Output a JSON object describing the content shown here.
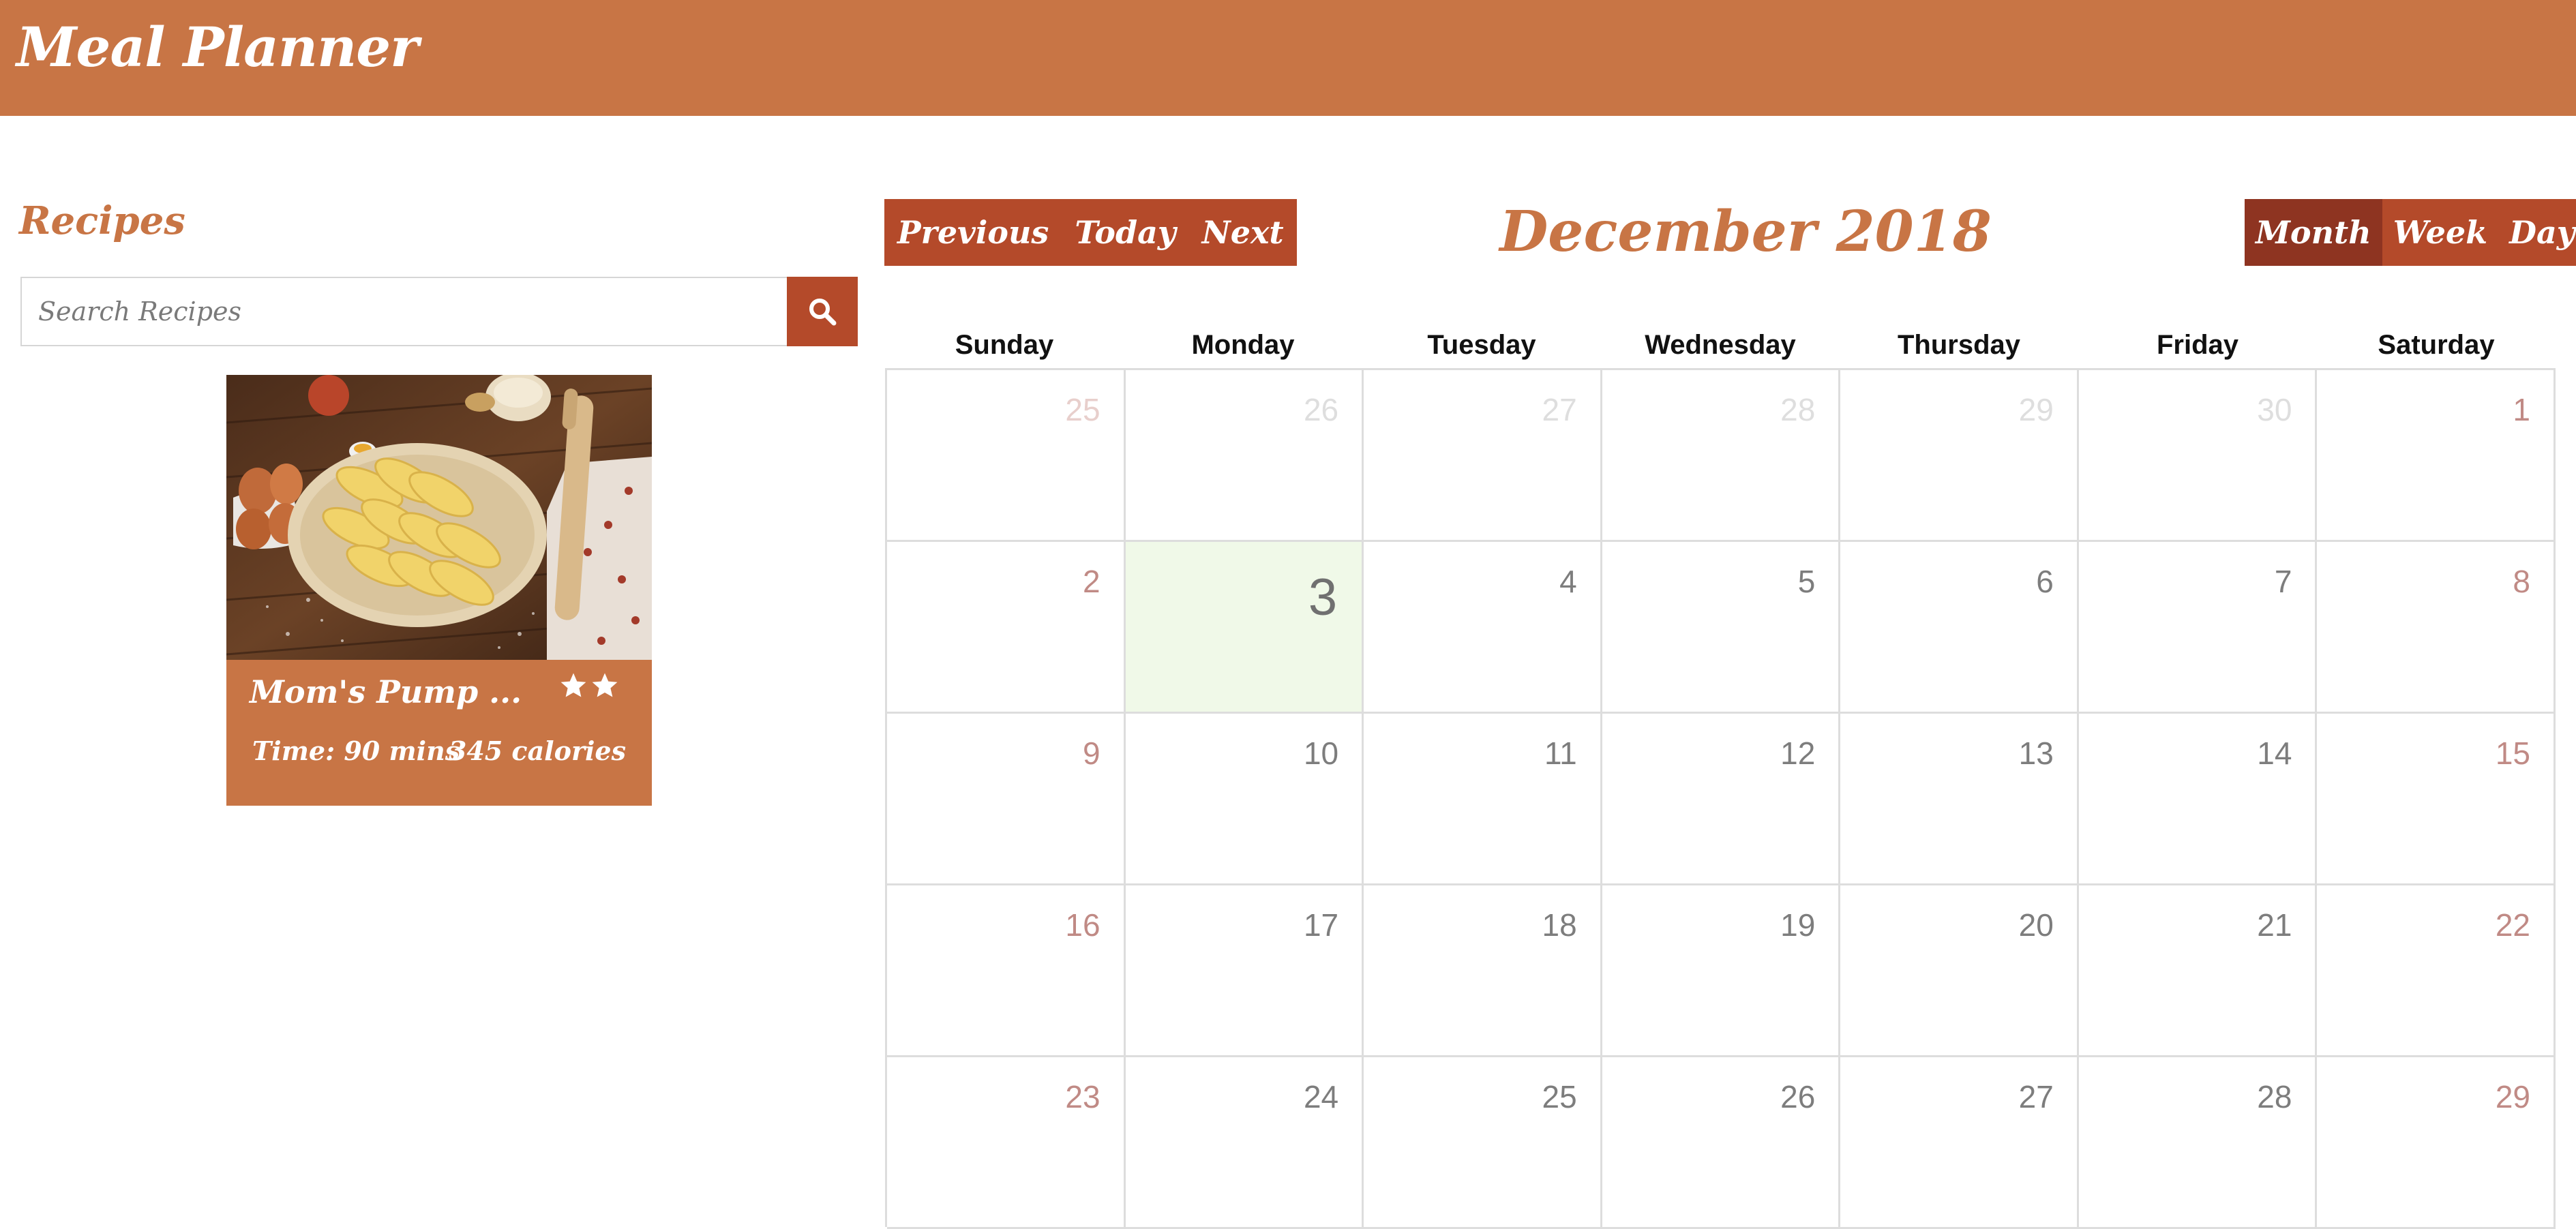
{
  "app": {
    "title": "Meal Planner"
  },
  "sidebar": {
    "heading": "Recipes",
    "search": {
      "placeholder": "Search Recipes",
      "value": ""
    },
    "recipes": [
      {
        "name": "Mom's Pump ...",
        "stars": 2,
        "time": "Time: 90 mins",
        "calories": "345 calories"
      }
    ]
  },
  "calendar": {
    "nav": {
      "previous": "Previous",
      "today": "Today",
      "next": "Next"
    },
    "title": "December 2018",
    "views": {
      "month": "Month",
      "week": "Week",
      "day": "Day",
      "active": "month"
    },
    "weekdays": [
      "Sunday",
      "Monday",
      "Tuesday",
      "Wednesday",
      "Thursday",
      "Friday",
      "Saturday"
    ],
    "weeks": [
      [
        "25",
        "26",
        "27",
        "28",
        "29",
        "30",
        "1"
      ],
      [
        "2",
        "3",
        "4",
        "5",
        "6",
        "7",
        "8"
      ],
      [
        "9",
        "10",
        "11",
        "12",
        "13",
        "14",
        "15"
      ],
      [
        "16",
        "17",
        "18",
        "19",
        "20",
        "21",
        "22"
      ],
      [
        "23",
        "24",
        "25",
        "26",
        "27",
        "28",
        "29"
      ]
    ],
    "other_month_cells": [
      [
        0,
        0
      ],
      [
        0,
        1
      ],
      [
        0,
        2
      ],
      [
        0,
        3
      ],
      [
        0,
        4
      ],
      [
        0,
        5
      ]
    ],
    "today_cell": [
      1,
      1
    ]
  },
  "colors": {
    "header": "#c87545",
    "button": "#b44a2a",
    "button_active": "#8e3421",
    "today_bg": "#f0f9e8",
    "weekend_text": "#c08a85"
  }
}
